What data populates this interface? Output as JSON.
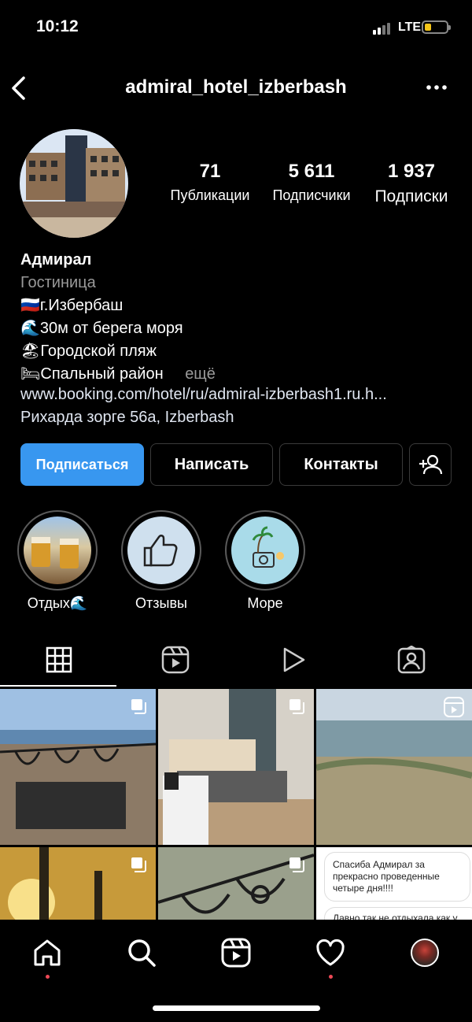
{
  "status_bar": {
    "time": "10:12",
    "network": "LTE"
  },
  "header": {
    "handle": "admiral_hotel_izberbash"
  },
  "stats": [
    {
      "value": "71",
      "label": "Публикации"
    },
    {
      "value": "5 611",
      "label": "Подписчики"
    },
    {
      "value": "1 937",
      "label": "Подписки"
    }
  ],
  "bio": {
    "name": "Адмирал",
    "category": "Гостиница",
    "lines": [
      {
        "emoji": "🇷🇺",
        "text": "г.Избербаш"
      },
      {
        "emoji": "🌊",
        "text": "30м от берега моря"
      },
      {
        "emoji": "🏖",
        "text": "Городской пляж"
      },
      {
        "emoji": "🛏",
        "text": "Спальный район"
      }
    ],
    "more": "ещё",
    "link": "www.booking.com/hotel/ru/admiral-izberbash1.ru.h...",
    "address": "Рихарда зорге 56а, Izberbash"
  },
  "buttons": {
    "follow": "Подписаться",
    "message": "Написать",
    "contacts": "Контакты"
  },
  "highlights": [
    {
      "label": "Отдых🌊"
    },
    {
      "label": "Отзывы"
    },
    {
      "label": "Море"
    }
  ],
  "grid_texts": {
    "review_1": "Спасиба Адмирал за прекрасно проведенные четыре дня!!!!",
    "review_2": "Давно так не отдыхала как у"
  },
  "colors": {
    "accent": "#3897f0",
    "notification": "#ed4956"
  },
  "icons": [
    "back-icon",
    "more-icon",
    "add-person-icon",
    "grid-icon",
    "reels-icon",
    "play-icon",
    "tagged-icon",
    "home-icon",
    "search-icon",
    "reels-nav-icon",
    "heart-icon"
  ]
}
